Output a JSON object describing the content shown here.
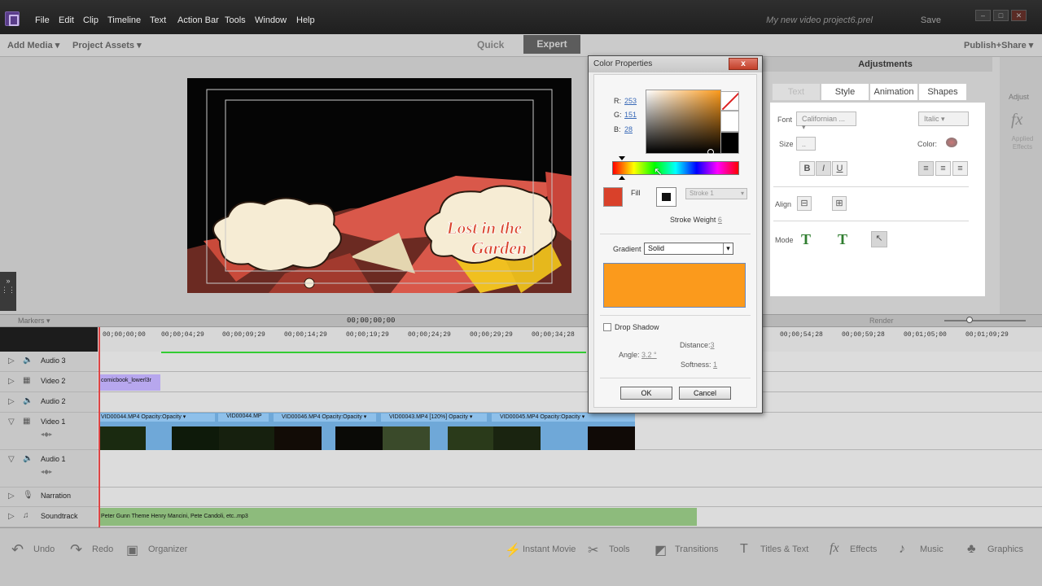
{
  "menu": [
    "File",
    "Edit",
    "Clip",
    "Timeline",
    "Text",
    "Action Bar",
    "Tools",
    "Window",
    "Help"
  ],
  "titlebar": {
    "doc_title": "My new video project6.prel",
    "save_label": "Save"
  },
  "toolbar": {
    "add_media": "Add Media",
    "project_assets": "Project Assets",
    "quick": "Quick",
    "expert": "Expert",
    "publish_share": "Publish+Share"
  },
  "canvas": {
    "title_line1": "Lost in the",
    "title_line2": "Garden"
  },
  "adjustments": {
    "header": "Adjustments",
    "tabs": [
      "Text",
      "Style",
      "Animation",
      "Shapes"
    ],
    "font_label": "Font",
    "font_value": "Californian ...",
    "style_value": "Italic",
    "size_label": "Size",
    "size_value": "..",
    "color_label": "Color:",
    "bold": "B",
    "italic": "I",
    "underline": "U",
    "align_label": "Align",
    "mode_label": "Mode",
    "mode_t": "T",
    "adjust_label": "Adjust",
    "applied_effects": "Applied Effects",
    "fx_glyph": "fx"
  },
  "dialog": {
    "title": "Color Properties",
    "close": "x",
    "r_label": "R:",
    "r_value": "253",
    "g_label": "G:",
    "g_value": "151",
    "b_label": "B:",
    "b_value": "28",
    "fill_label": "Fill",
    "stroke_label": "Stroke 1",
    "stroke_weight_label": "Stroke Weight",
    "stroke_weight_value": "6",
    "gradient_label": "Gradient",
    "gradient_value": "Solid",
    "drop_shadow_label": "Drop Shadow",
    "distance_label": "Distance:",
    "distance_value": "3",
    "angle_label": "Angle:",
    "angle_value": "3.2 °",
    "softness_label": "Softness:",
    "softness_value": "1",
    "ok": "OK",
    "cancel": "Cancel",
    "preview_color": "#fb9a1c",
    "fill_color": "#d9412a"
  },
  "timeline": {
    "markers": "Markers",
    "timecode": "00;00;00;00",
    "render": "Render",
    "ticks": [
      "00;00;00;00",
      "00;00;04;29",
      "00;00;09;29",
      "00;00;14;29",
      "00;00;19;29",
      "00;00;24;29",
      "00;00;29;29",
      "00;00;34;28",
      "00;00;54;28",
      "00;00;59;28",
      "00;01;05;00",
      "00;01;09;29"
    ],
    "tracks": [
      "Audio 3",
      "Video 2",
      "Audio 2",
      "Video 1",
      "Audio 1",
      "Narration",
      "Soundtrack"
    ],
    "title_clip": "comicbook_lowerl3r",
    "video_clips": [
      "VID00044.MP4  Opacity:Opacity ▾",
      "VID00044.MP",
      "VID00046.MP4  Opacity:Opacity ▾",
      "VID00043.MP4 [120%]  Opacity ▾",
      "VID00045.MP4  Opacity:Opacity ▾"
    ],
    "soundtrack_clip": "Peter Gunn Theme Henry Mancini, Pete Candoli, etc..mp3"
  },
  "bottom_bar": {
    "undo": "Undo",
    "redo": "Redo",
    "organizer": "Organizer",
    "instant_movie": "Instant Movie",
    "tools": "Tools",
    "transitions": "Transitions",
    "titles_text": "Titles & Text",
    "effects": "Effects",
    "music": "Music",
    "graphics": "Graphics"
  },
  "colors": {
    "accent_orange": "#fb9a1c",
    "fill_red": "#d9412a",
    "playhead": "#dd4444"
  }
}
